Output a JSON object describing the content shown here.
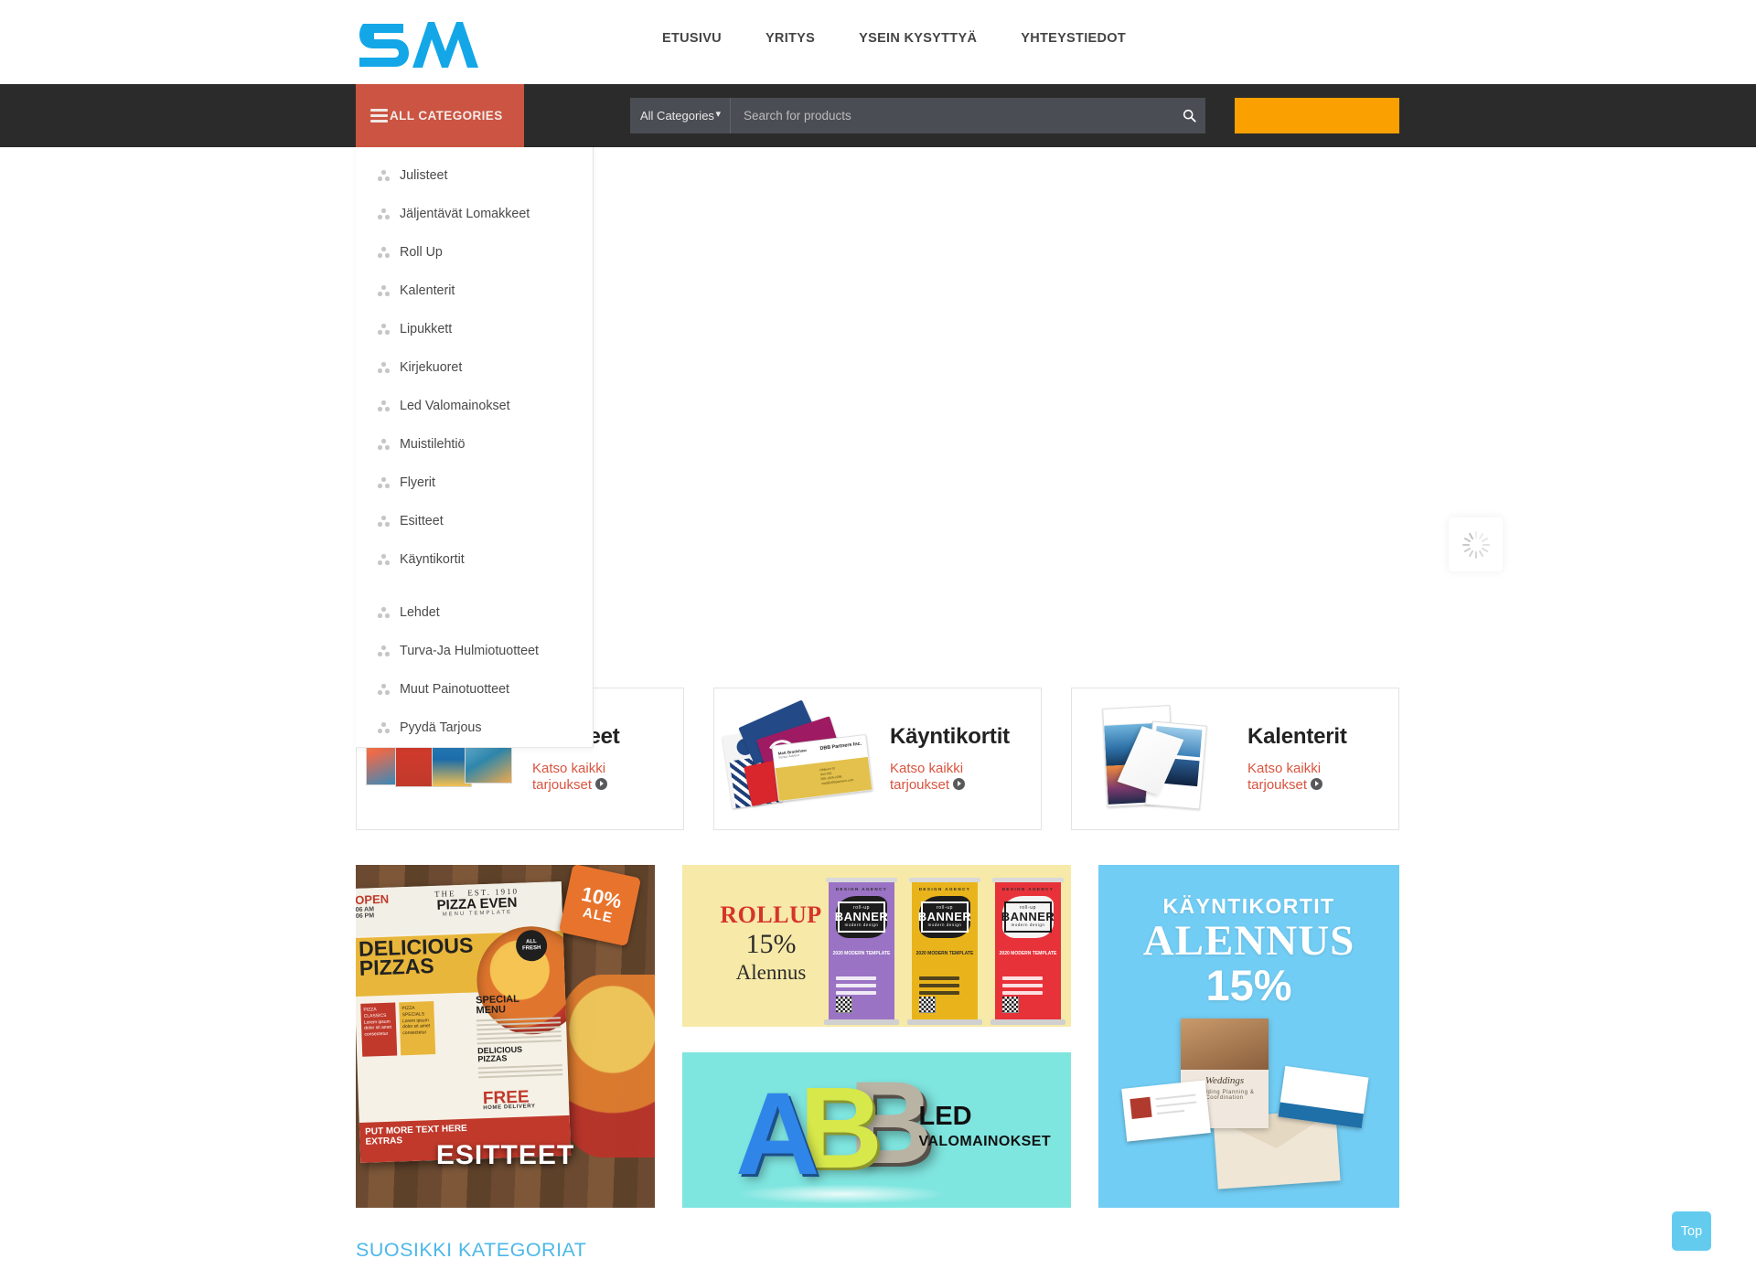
{
  "header": {
    "logo_text": "SM",
    "logo_color": "#13a7e8",
    "nav": [
      {
        "label": "ETUSIVU"
      },
      {
        "label": "YRITYS"
      },
      {
        "label": "YSEIN KYSYTTYÄ"
      },
      {
        "label": "YHTEYSTIEDOT"
      }
    ]
  },
  "toolbar": {
    "all_categories_label": "ALL CATEGORIES",
    "all_categories_color": "#cb5442",
    "bar_color": "#2b2b2b",
    "category_select_value": "All Categories",
    "category_select_options": [
      "All Categories"
    ],
    "search_placeholder": "Search for products",
    "search_value": "",
    "search_icon": "search-icon",
    "cart_color": "#faa000"
  },
  "category_menu": {
    "items": [
      {
        "label": "Julisteet",
        "icon": "sitemap-icon"
      },
      {
        "label": "Jäljentävät Lomakkeet",
        "icon": "sitemap-icon"
      },
      {
        "label": "Roll Up",
        "icon": "sitemap-icon"
      },
      {
        "label": "Kalenterit",
        "icon": "sitemap-icon"
      },
      {
        "label": "Lipukkett",
        "icon": "sitemap-icon"
      },
      {
        "label": "Kirjekuoret",
        "icon": "sitemap-icon"
      },
      {
        "label": "Led Valomainokset",
        "icon": "sitemap-icon"
      },
      {
        "label": "Muistilehtiö",
        "icon": "sitemap-icon"
      },
      {
        "label": "Flyerit",
        "icon": "sitemap-icon"
      },
      {
        "label": "Esitteet",
        "icon": "sitemap-icon"
      },
      {
        "label": "Käyntikortit",
        "icon": "sitemap-icon"
      },
      {
        "label": "Lehdet",
        "icon": "sitemap-icon"
      },
      {
        "label": "Turva-Ja Hulmiotuotteet",
        "icon": "sitemap-icon"
      },
      {
        "label": "Muut Painotuotteet",
        "icon": "sitemap-icon"
      },
      {
        "label": "Pyydä Tarjous",
        "icon": "sitemap-icon"
      }
    ]
  },
  "slider": {
    "state": "loading",
    "spinner_icon": "loading-spinner-icon"
  },
  "promo_cards": [
    {
      "title": "Julisteet",
      "link_text": "Katso kaikki tarjoukset",
      "thumb": "posters-image"
    },
    {
      "title": "Käyntikortit",
      "link_text": "Katso kaikki tarjoukset",
      "thumb": "business-cards-image"
    },
    {
      "title": "Kalenterit",
      "link_text": "Katso kaikki tarjoukset",
      "thumb": "calendars-image"
    }
  ],
  "banners": {
    "pizza": {
      "badge_percent": "10%",
      "badge_label": "ALE",
      "caption": "ESITTEET",
      "flyer": {
        "open_label": "OPEN",
        "open_time": "06 AM",
        "open_time2": "06 PM",
        "the_label": "THE",
        "since": "EST. 1910",
        "title": "PIZZA EVEN",
        "subtitle": "MENU TEMPLATE",
        "headline": "DELICIOUS PIZZAS",
        "all_fresh": "ALL FRESH",
        "col1_title": "PIZZA CLASSICS",
        "col2_title": "PIZZA SPECIALS",
        "menu_title": "SPECIAL MENU",
        "menu_sub": "DELICIOUS PIZZAS",
        "free_text": "FREE",
        "free_sub": "HOME DELIVERY",
        "footer": "PUT MORE TEXT HERE EXTRAS"
      }
    },
    "rollup": {
      "line1": "ROLLUP",
      "line2": "15%",
      "line3": "Alennus",
      "bg_color": "#f7e9a8",
      "banners": [
        {
          "agency": "DESIGN AGENCY",
          "small": "roll-up",
          "big": "BANNER",
          "sub": "modern design",
          "meta": "2020 MODERN TEMPLATE",
          "color": "#9b73c4"
        },
        {
          "agency": "DESIGN AGENCY",
          "small": "roll-up",
          "big": "BANNER",
          "sub": "modern design",
          "meta": "2020 MODERN TEMPLATE",
          "color": "#e9b41b"
        },
        {
          "agency": "DESIGN AGENCY",
          "small": "roll-up",
          "big": "BANNER",
          "sub": "modern design",
          "meta": "2020 MODERN TEMPLATE",
          "color": "#e8323a"
        }
      ]
    },
    "led": {
      "line1": "LED",
      "line2": "VALOMAINOKSET",
      "letters": [
        "A",
        "B",
        "B"
      ],
      "bg_color": "#7fe5df"
    },
    "business_cards": {
      "line1": "KÄYNTIKORTIT",
      "line2": "ALENNUS",
      "line3": "15%",
      "bg_color": "#72cdf4",
      "art_title": "Weddings",
      "art_sub": "Wedding Planning & Coordination"
    }
  },
  "section": {
    "title": "SUOSIKKI KATEGORIAT",
    "title_color": "#4cb8e8"
  },
  "scroll_top": {
    "label": "Top",
    "color": "#63ccee"
  }
}
